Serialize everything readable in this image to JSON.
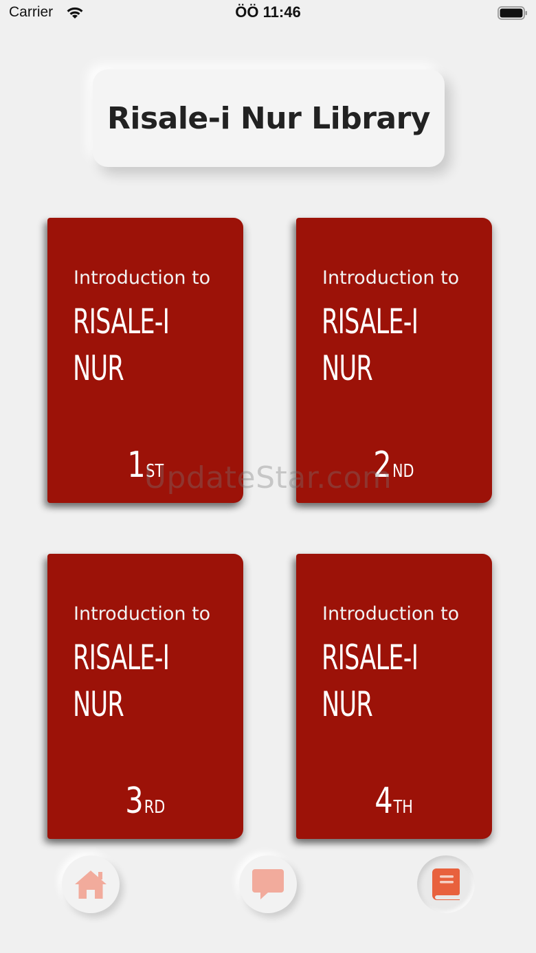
{
  "status_bar": {
    "carrier": "Carrier",
    "time": "ÖÖ 11:46"
  },
  "header": {
    "title": "Risale-i Nur Library"
  },
  "books": [
    {
      "intro": "Introduction to",
      "line1": "RISALE-I",
      "line2": "NUR",
      "number": "1",
      "suffix": "ST"
    },
    {
      "intro": "Introduction to",
      "line1": "RISALE-I",
      "line2": "NUR",
      "number": "2",
      "suffix": "ND"
    },
    {
      "intro": "Introduction to",
      "line1": "RISALE-I",
      "line2": "NUR",
      "number": "3",
      "suffix": "RD"
    },
    {
      "intro": "Introduction to",
      "line1": "RISALE-I",
      "line2": "NUR",
      "number": "4",
      "suffix": "TH"
    }
  ],
  "watermark": "UpdateStar.com",
  "nav": {
    "items": [
      {
        "icon": "home-icon",
        "active": false
      },
      {
        "icon": "chat-icon",
        "active": false
      },
      {
        "icon": "book-icon",
        "active": true
      }
    ]
  },
  "colors": {
    "background": "#f0f0f0",
    "book_red": "#9c1208",
    "nav_inactive": "#f2ab9c",
    "nav_active": "#e8613d"
  }
}
